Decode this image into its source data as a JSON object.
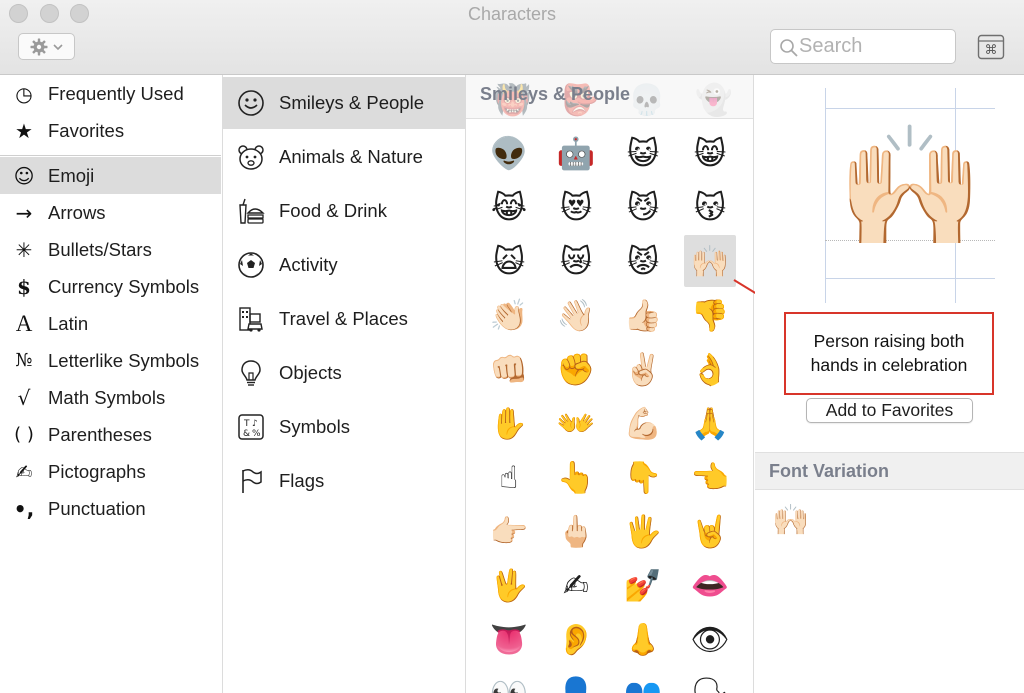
{
  "window": {
    "title": "Characters"
  },
  "toolbar": {
    "gear_icon": "gear-icon",
    "search_placeholder": "Search"
  },
  "sidebar": {
    "items": [
      {
        "label": "Frequently Used",
        "glyph": "◷"
      },
      {
        "label": "Favorites",
        "glyph": "★"
      },
      {
        "label": "Emoji",
        "glyph": "☺",
        "selected": true
      },
      {
        "label": "Arrows",
        "glyph": "→"
      },
      {
        "label": "Bullets/Stars",
        "glyph": "✳"
      },
      {
        "label": "Currency Symbols",
        "glyph": "$"
      },
      {
        "label": "Latin",
        "glyph": "A"
      },
      {
        "label": "Letterlike Symbols",
        "glyph": "№"
      },
      {
        "label": "Math Symbols",
        "glyph": "√"
      },
      {
        "label": "Parentheses",
        "glyph": "( )"
      },
      {
        "label": "Pictographs",
        "glyph": "✍"
      },
      {
        "label": "Punctuation",
        "glyph": "•,"
      }
    ]
  },
  "categories": {
    "items": [
      {
        "label": "Smileys & People",
        "selected": true
      },
      {
        "label": "Animals & Nature"
      },
      {
        "label": "Food & Drink"
      },
      {
        "label": "Activity"
      },
      {
        "label": "Travel & Places"
      },
      {
        "label": "Objects"
      },
      {
        "label": "Symbols"
      },
      {
        "label": "Flags"
      }
    ]
  },
  "grid": {
    "header": "Smileys & People",
    "faded_row": [
      "👹",
      "👺",
      "💀",
      "👻"
    ],
    "rows": [
      [
        "👽",
        "🤖",
        "😺",
        "😸"
      ],
      [
        "😹",
        "😻",
        "😼",
        "😽"
      ],
      [
        "🙀",
        "😿",
        "😾",
        "🙌🏻"
      ],
      [
        "👏🏻",
        "👋🏻",
        "👍🏻",
        "👎"
      ],
      [
        "👊🏻",
        "✊",
        "✌🏻",
        "👌"
      ],
      [
        "✋",
        "👐",
        "💪🏻",
        "🙏"
      ],
      [
        "☝",
        "👆",
        "👇",
        "👈"
      ],
      [
        "👉🏻",
        "🖕🏻",
        "🖐",
        "🤘"
      ],
      [
        "🖖",
        "✍",
        "💅",
        "👄"
      ],
      [
        "👅",
        "👂",
        "👃",
        "👁"
      ],
      [
        "👀",
        "👤",
        "👥",
        "🗣"
      ]
    ],
    "selected": "🙌🏻"
  },
  "preview": {
    "character": "🙌🏻",
    "name": "Person raising both hands in celebration",
    "add_favorites_label": "Add to Favorites",
    "font_variation_label": "Font Variation",
    "variation_character": "🙌🏻"
  },
  "colors": {
    "annotation": "#d8352a",
    "selection": "#dcdcdc",
    "section_header": "#7a7f8c"
  }
}
